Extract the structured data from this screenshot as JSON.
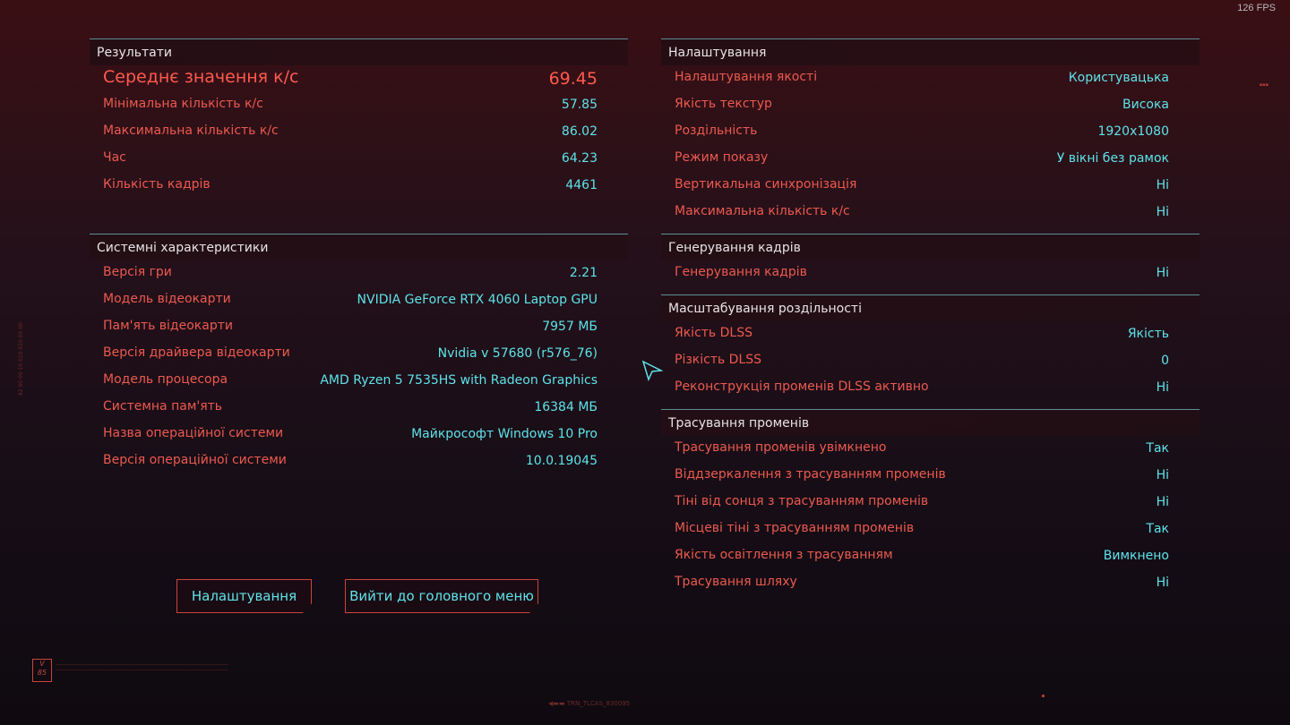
{
  "fps_counter": "126 FPS",
  "results": {
    "title": "Результати",
    "avg_label": "Середнє значення к/с",
    "avg_value": "69.45",
    "rows": [
      {
        "label": "Мінімальна кількість к/с",
        "value": "57.85"
      },
      {
        "label": "Максимальна кількість к/с",
        "value": "86.02"
      },
      {
        "label": "Час",
        "value": "64.23"
      },
      {
        "label": "Кількість кадрів",
        "value": "4461"
      }
    ]
  },
  "system": {
    "title": "Системні характеристики",
    "rows": [
      {
        "label": "Версія гри",
        "value": "2.21"
      },
      {
        "label": "Модель відеокарти",
        "value": "NVIDIA GeForce RTX 4060 Laptop GPU"
      },
      {
        "label": "Пам'ять відеокарти",
        "value": "7957 МБ"
      },
      {
        "label": "Версія драйвера відеокарти",
        "value": "Nvidia v 57680 (r576_76)"
      },
      {
        "label": "Модель процесора",
        "value": "AMD Ryzen 5 7535HS with Radeon Graphics"
      },
      {
        "label": "Системна пам'ять",
        "value": "16384 МБ"
      },
      {
        "label": "Назва операційної системи",
        "value": "Майкрософт Windows 10 Pro"
      },
      {
        "label": "Версія операційної системи",
        "value": "10.0.19045"
      }
    ]
  },
  "settings": {
    "title": "Налаштування",
    "rows": [
      {
        "label": "Налаштування якості",
        "value": "Користувацька"
      },
      {
        "label": "Якість текстур",
        "value": "Висока"
      },
      {
        "label": "Роздільність",
        "value": "1920x1080"
      },
      {
        "label": "Режим показу",
        "value": "У вікні без рамок"
      },
      {
        "label": "Вертикальна синхронізація",
        "value": "Ні"
      },
      {
        "label": "Максимальна кількість к/с",
        "value": "Ні"
      }
    ]
  },
  "frame_gen": {
    "title": "Генерування кадрів",
    "rows": [
      {
        "label": "Генерування кадрів",
        "value": "Ні"
      }
    ]
  },
  "scaling": {
    "title": "Масштабування роздільності",
    "rows": [
      {
        "label": "Якість DLSS",
        "value": "Якість"
      },
      {
        "label": "Різкість DLSS",
        "value": "0"
      },
      {
        "label": "Реконструкція променів DLSS активно",
        "value": "Ні"
      }
    ]
  },
  "raytracing": {
    "title": "Трасування променів",
    "rows": [
      {
        "label": "Трасування променів увімкнено",
        "value": "Так"
      },
      {
        "label": "Віддзеркалення з трасуванням променів",
        "value": "Ні"
      },
      {
        "label": "Тіні від сонця з трасуванням променів",
        "value": "Ні"
      },
      {
        "label": "Місцеві тіні з трасуванням променів",
        "value": "Так"
      },
      {
        "label": "Якість освітлення з трасуванням",
        "value": "Вимкнено"
      },
      {
        "label": "Трасування шляху",
        "value": "Ні"
      }
    ]
  },
  "buttons": {
    "settings": "Налаштування",
    "exit": "Вийти до головного меню"
  },
  "badge_text": "V\n85",
  "bottom_tag": "TRN_TLCAS_830095",
  "colors": {
    "label_red": "#ec5a4f",
    "value_cyan": "#5fe3ea",
    "divider": "#5f8f95"
  }
}
